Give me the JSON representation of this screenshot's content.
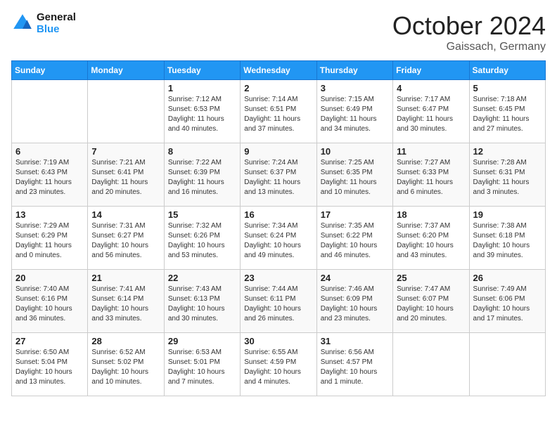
{
  "header": {
    "logo_general": "General",
    "logo_blue": "Blue",
    "month_title": "October 2024",
    "location": "Gaissach, Germany"
  },
  "days_of_week": [
    "Sunday",
    "Monday",
    "Tuesday",
    "Wednesday",
    "Thursday",
    "Friday",
    "Saturday"
  ],
  "weeks": [
    [
      {
        "day": "",
        "info": ""
      },
      {
        "day": "",
        "info": ""
      },
      {
        "day": "1",
        "info": "Sunrise: 7:12 AM\nSunset: 6:53 PM\nDaylight: 11 hours and 40 minutes."
      },
      {
        "day": "2",
        "info": "Sunrise: 7:14 AM\nSunset: 6:51 PM\nDaylight: 11 hours and 37 minutes."
      },
      {
        "day": "3",
        "info": "Sunrise: 7:15 AM\nSunset: 6:49 PM\nDaylight: 11 hours and 34 minutes."
      },
      {
        "day": "4",
        "info": "Sunrise: 7:17 AM\nSunset: 6:47 PM\nDaylight: 11 hours and 30 minutes."
      },
      {
        "day": "5",
        "info": "Sunrise: 7:18 AM\nSunset: 6:45 PM\nDaylight: 11 hours and 27 minutes."
      }
    ],
    [
      {
        "day": "6",
        "info": "Sunrise: 7:19 AM\nSunset: 6:43 PM\nDaylight: 11 hours and 23 minutes."
      },
      {
        "day": "7",
        "info": "Sunrise: 7:21 AM\nSunset: 6:41 PM\nDaylight: 11 hours and 20 minutes."
      },
      {
        "day": "8",
        "info": "Sunrise: 7:22 AM\nSunset: 6:39 PM\nDaylight: 11 hours and 16 minutes."
      },
      {
        "day": "9",
        "info": "Sunrise: 7:24 AM\nSunset: 6:37 PM\nDaylight: 11 hours and 13 minutes."
      },
      {
        "day": "10",
        "info": "Sunrise: 7:25 AM\nSunset: 6:35 PM\nDaylight: 11 hours and 10 minutes."
      },
      {
        "day": "11",
        "info": "Sunrise: 7:27 AM\nSunset: 6:33 PM\nDaylight: 11 hours and 6 minutes."
      },
      {
        "day": "12",
        "info": "Sunrise: 7:28 AM\nSunset: 6:31 PM\nDaylight: 11 hours and 3 minutes."
      }
    ],
    [
      {
        "day": "13",
        "info": "Sunrise: 7:29 AM\nSunset: 6:29 PM\nDaylight: 11 hours and 0 minutes."
      },
      {
        "day": "14",
        "info": "Sunrise: 7:31 AM\nSunset: 6:27 PM\nDaylight: 10 hours and 56 minutes."
      },
      {
        "day": "15",
        "info": "Sunrise: 7:32 AM\nSunset: 6:26 PM\nDaylight: 10 hours and 53 minutes."
      },
      {
        "day": "16",
        "info": "Sunrise: 7:34 AM\nSunset: 6:24 PM\nDaylight: 10 hours and 49 minutes."
      },
      {
        "day": "17",
        "info": "Sunrise: 7:35 AM\nSunset: 6:22 PM\nDaylight: 10 hours and 46 minutes."
      },
      {
        "day": "18",
        "info": "Sunrise: 7:37 AM\nSunset: 6:20 PM\nDaylight: 10 hours and 43 minutes."
      },
      {
        "day": "19",
        "info": "Sunrise: 7:38 AM\nSunset: 6:18 PM\nDaylight: 10 hours and 39 minutes."
      }
    ],
    [
      {
        "day": "20",
        "info": "Sunrise: 7:40 AM\nSunset: 6:16 PM\nDaylight: 10 hours and 36 minutes."
      },
      {
        "day": "21",
        "info": "Sunrise: 7:41 AM\nSunset: 6:14 PM\nDaylight: 10 hours and 33 minutes."
      },
      {
        "day": "22",
        "info": "Sunrise: 7:43 AM\nSunset: 6:13 PM\nDaylight: 10 hours and 30 minutes."
      },
      {
        "day": "23",
        "info": "Sunrise: 7:44 AM\nSunset: 6:11 PM\nDaylight: 10 hours and 26 minutes."
      },
      {
        "day": "24",
        "info": "Sunrise: 7:46 AM\nSunset: 6:09 PM\nDaylight: 10 hours and 23 minutes."
      },
      {
        "day": "25",
        "info": "Sunrise: 7:47 AM\nSunset: 6:07 PM\nDaylight: 10 hours and 20 minutes."
      },
      {
        "day": "26",
        "info": "Sunrise: 7:49 AM\nSunset: 6:06 PM\nDaylight: 10 hours and 17 minutes."
      }
    ],
    [
      {
        "day": "27",
        "info": "Sunrise: 6:50 AM\nSunset: 5:04 PM\nDaylight: 10 hours and 13 minutes."
      },
      {
        "day": "28",
        "info": "Sunrise: 6:52 AM\nSunset: 5:02 PM\nDaylight: 10 hours and 10 minutes."
      },
      {
        "day": "29",
        "info": "Sunrise: 6:53 AM\nSunset: 5:01 PM\nDaylight: 10 hours and 7 minutes."
      },
      {
        "day": "30",
        "info": "Sunrise: 6:55 AM\nSunset: 4:59 PM\nDaylight: 10 hours and 4 minutes."
      },
      {
        "day": "31",
        "info": "Sunrise: 6:56 AM\nSunset: 4:57 PM\nDaylight: 10 hours and 1 minute."
      },
      {
        "day": "",
        "info": ""
      },
      {
        "day": "",
        "info": ""
      }
    ]
  ]
}
